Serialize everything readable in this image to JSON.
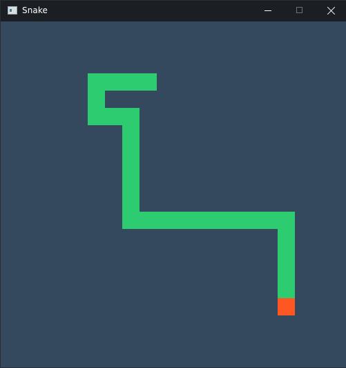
{
  "window": {
    "title": "Snake",
    "icon": "app-window-icon",
    "controls": [
      "minimize-icon",
      "maximize-icon",
      "close-icon"
    ]
  },
  "game": {
    "background_color": "#34495e",
    "snake_color": "#2ecc71",
    "food_color": "#ff5722",
    "grid_columns": 20,
    "grid_rows": 20,
    "snake": [
      [
        8,
        3
      ],
      [
        7,
        3
      ],
      [
        6,
        3
      ],
      [
        5,
        3
      ],
      [
        5,
        4
      ],
      [
        5,
        5
      ],
      [
        6,
        5
      ],
      [
        7,
        6
      ],
      [
        7,
        5
      ],
      [
        7,
        7
      ],
      [
        7,
        8
      ],
      [
        7,
        9
      ],
      [
        7,
        10
      ],
      [
        7,
        11
      ],
      [
        8,
        11
      ],
      [
        9,
        11
      ],
      [
        10,
        11
      ],
      [
        11,
        11
      ],
      [
        12,
        11
      ],
      [
        13,
        11
      ],
      [
        14,
        11
      ],
      [
        15,
        11
      ],
      [
        16,
        11
      ],
      [
        16,
        12
      ],
      [
        16,
        13
      ],
      [
        16,
        14
      ],
      [
        16,
        15
      ]
    ],
    "food": [
      16,
      16
    ]
  }
}
